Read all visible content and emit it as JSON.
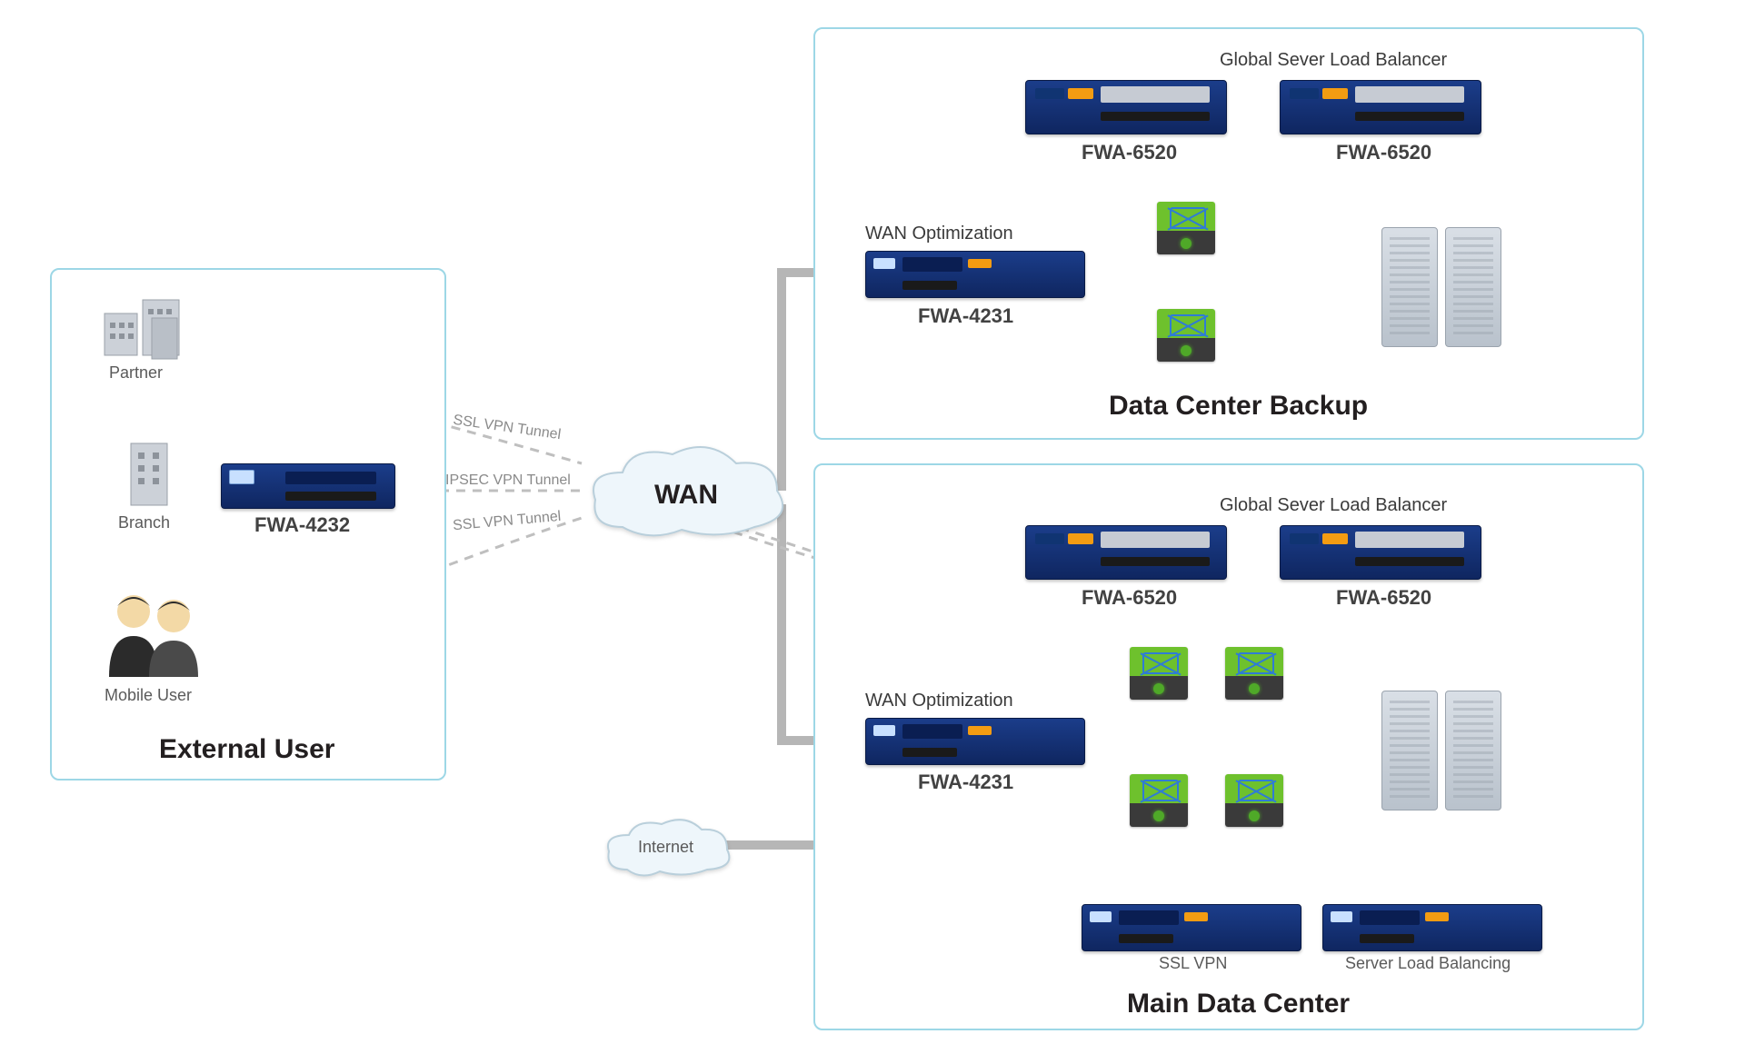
{
  "zones": {
    "external_user_title": "External User",
    "dc_backup_title": "Data Center Backup",
    "main_dc_title": "Main Data Center"
  },
  "labels": {
    "partner": "Partner",
    "branch": "Branch",
    "mobile_user": "Mobile User",
    "wan": "WAN",
    "internet": "Internet",
    "wan_opt_backup": "WAN Optimization",
    "wan_opt_main": "WAN Optimization",
    "gslb_backup": "Global Sever Load Balancer",
    "gslb_main": "Global Sever Load Balancer",
    "ssl_vpn": "SSL VPN",
    "server_lb": "Server Load Balancing"
  },
  "devices": {
    "fwa4232": "FWA-4232",
    "fwa4231_backup": "FWA-4231",
    "fwa4231_main": "FWA-4231",
    "fwa6520_b1": "FWA-6520",
    "fwa6520_b2": "FWA-6520",
    "fwa6520_m1": "FWA-6520",
    "fwa6520_m2": "FWA-6520"
  },
  "vpn": {
    "ssl_top": "SSL VPN Tunnel",
    "ipsec": "IPSEC VPN Tunnel",
    "ssl_bottom": "SSL VPN Tunnel"
  },
  "colors": {
    "zone_border": "#9dd7e6",
    "solid_line": "#b6b6b6",
    "dashed_line": "#bfbfbf",
    "appliance_blue_top": "#1b3d8a",
    "appliance_blue_bottom": "#0f2660",
    "switch_green": "#6ec12d"
  },
  "topology": {
    "nodes": [
      {
        "id": "partner",
        "type": "building",
        "zone": "external_user"
      },
      {
        "id": "branch",
        "type": "building",
        "zone": "external_user"
      },
      {
        "id": "mobile_user",
        "type": "people",
        "zone": "external_user"
      },
      {
        "id": "fwa4232",
        "type": "appliance",
        "zone": "external_user",
        "model": "FWA-4232"
      },
      {
        "id": "wan",
        "type": "cloud"
      },
      {
        "id": "internet",
        "type": "cloud"
      },
      {
        "id": "b_fwa4231",
        "type": "appliance",
        "zone": "dc_backup",
        "model": "FWA-4231",
        "role": "WAN Optimization"
      },
      {
        "id": "b_fwa6520_1",
        "type": "appliance",
        "zone": "dc_backup",
        "model": "FWA-6520",
        "role": "Global Server Load Balancer"
      },
      {
        "id": "b_fwa6520_2",
        "type": "appliance",
        "zone": "dc_backup",
        "model": "FWA-6520",
        "role": "Global Server Load Balancer"
      },
      {
        "id": "b_sw1",
        "type": "switch",
        "zone": "dc_backup"
      },
      {
        "id": "b_sw2",
        "type": "switch",
        "zone": "dc_backup"
      },
      {
        "id": "b_rack",
        "type": "server-rack",
        "zone": "dc_backup"
      },
      {
        "id": "m_fwa4231",
        "type": "appliance",
        "zone": "main_dc",
        "model": "FWA-4231",
        "role": "WAN Optimization"
      },
      {
        "id": "m_fwa6520_1",
        "type": "appliance",
        "zone": "main_dc",
        "model": "FWA-6520",
        "role": "Global Server Load Balancer"
      },
      {
        "id": "m_fwa6520_2",
        "type": "appliance",
        "zone": "main_dc",
        "model": "FWA-6520",
        "role": "Global Server Load Balancer"
      },
      {
        "id": "m_sw1",
        "type": "switch",
        "zone": "main_dc"
      },
      {
        "id": "m_sw2",
        "type": "switch",
        "zone": "main_dc"
      },
      {
        "id": "m_sw3",
        "type": "switch",
        "zone": "main_dc"
      },
      {
        "id": "m_sw4",
        "type": "switch",
        "zone": "main_dc"
      },
      {
        "id": "m_rack",
        "type": "server-rack",
        "zone": "main_dc"
      },
      {
        "id": "m_sslvpn",
        "type": "appliance",
        "zone": "main_dc",
        "role": "SSL VPN"
      },
      {
        "id": "m_slb",
        "type": "appliance",
        "zone": "main_dc",
        "role": "Server Load Balancing"
      }
    ],
    "edges": [
      {
        "from": "partner",
        "to": "wan",
        "style": "dashed",
        "label": "SSL VPN Tunnel"
      },
      {
        "from": "fwa4232",
        "to": "wan",
        "style": "dashed",
        "label": "IPSEC VPN Tunnel"
      },
      {
        "from": "mobile_user",
        "to": "wan",
        "style": "dashed",
        "label": "SSL VPN Tunnel"
      },
      {
        "from": "branch",
        "to": "fwa4232",
        "style": "implicit"
      },
      {
        "from": "wan",
        "to": "b_fwa4231",
        "style": "solid"
      },
      {
        "from": "wan",
        "to": "m_fwa4231",
        "style": "solid"
      },
      {
        "from": "wan",
        "to": "m_sw1",
        "style": "dashed"
      },
      {
        "from": "wan",
        "to": "m_sw2",
        "style": "dashed"
      },
      {
        "from": "internet",
        "to": "m_sw3",
        "style": "solid"
      },
      {
        "from": "b_fwa4231",
        "to": "b_sw1",
        "style": "solid"
      },
      {
        "from": "b_fwa4231",
        "to": "b_sw2",
        "style": "solid"
      },
      {
        "from": "b_fwa6520_1",
        "to": "b_sw1",
        "style": "solid"
      },
      {
        "from": "b_fwa6520_2",
        "to": "b_sw1",
        "style": "solid"
      },
      {
        "from": "b_sw1",
        "to": "b_sw2",
        "style": "solid"
      },
      {
        "from": "b_sw2",
        "to": "b_rack",
        "style": "solid"
      },
      {
        "from": "m_fwa4231",
        "to": "m_sw1",
        "style": "solid"
      },
      {
        "from": "m_fwa4231",
        "to": "m_sw3",
        "style": "solid"
      },
      {
        "from": "m_fwa6520_1",
        "to": "m_sw1",
        "style": "solid"
      },
      {
        "from": "m_fwa6520_2",
        "to": "m_sw2",
        "style": "solid"
      },
      {
        "from": "m_sw1",
        "to": "m_sw2",
        "style": "solid"
      },
      {
        "from": "m_sw1",
        "to": "m_sw3",
        "style": "solid"
      },
      {
        "from": "m_sw2",
        "to": "m_sw4",
        "style": "solid"
      },
      {
        "from": "m_sw3",
        "to": "m_sw4",
        "style": "solid"
      },
      {
        "from": "m_sw2",
        "to": "m_rack",
        "style": "solid"
      },
      {
        "from": "m_sw4",
        "to": "m_rack",
        "style": "solid"
      },
      {
        "from": "m_sw3",
        "to": "m_sslvpn",
        "style": "solid"
      },
      {
        "from": "m_sw4",
        "to": "m_slb",
        "style": "solid"
      }
    ]
  }
}
